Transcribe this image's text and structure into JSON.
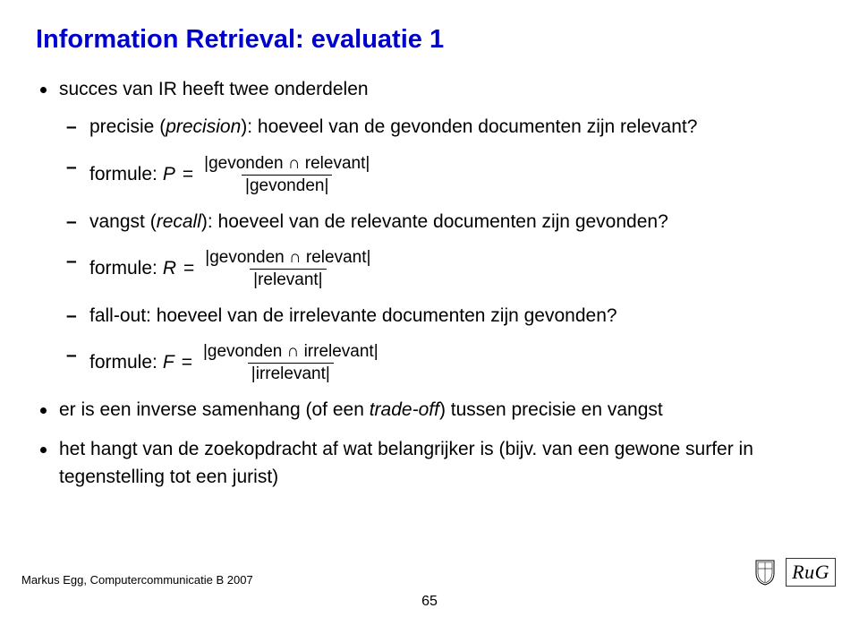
{
  "slide": {
    "title": "Information Retrieval: evaluatie 1",
    "bullets": [
      {
        "text": "succes van IR heeft twee onderdelen",
        "children": [
          {
            "text_prefix": "precisie (",
            "text_italic": "precision",
            "text_suffix": "): hoeveel van de gevonden documenten zijn relevant?"
          },
          {
            "formula_label": "formule:",
            "lhs": "P",
            "eq": "=",
            "num": "|gevonden ∩ relevant|",
            "den": "|gevonden|"
          },
          {
            "text_prefix": "vangst (",
            "text_italic": "recall",
            "text_suffix": "): hoeveel van de relevante documenten zijn gevonden?"
          },
          {
            "formula_label": "formule:",
            "lhs": "R",
            "eq": "=",
            "num": "|gevonden ∩ relevant|",
            "den": "|relevant|"
          },
          {
            "text": "fall-out: hoeveel van de irrelevante documenten zijn gevonden?"
          },
          {
            "formula_label": "formule:",
            "lhs": "F",
            "eq": "=",
            "num": "|gevonden ∩ irrelevant|",
            "den": "|irrelevant|"
          }
        ]
      },
      {
        "text_prefix": "er is een inverse samenhang (of een ",
        "text_italic": "trade-off",
        "text_suffix": ") tussen precisie en vangst"
      },
      {
        "text": "het hangt van de zoekopdracht af wat belangrijker is (bijv. van een gewone surfer in tegenstelling tot een jurist)"
      }
    ]
  },
  "footer": {
    "left": "Markus Egg, Computercommunicatie B 2007",
    "page": "65",
    "logo": "RuG"
  }
}
